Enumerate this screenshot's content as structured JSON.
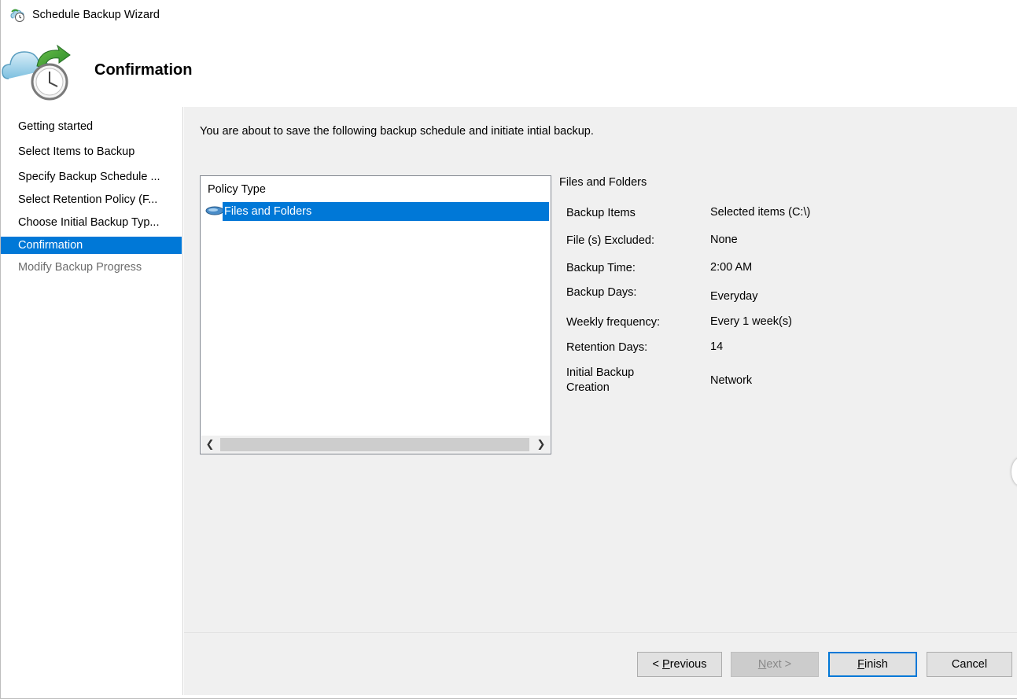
{
  "window": {
    "title": "Schedule Backup Wizard"
  },
  "header": {
    "title": "Confirmation",
    "icon": "cloud-backup-clock-icon"
  },
  "nav": {
    "items": [
      {
        "label": "Getting started",
        "state": "normal"
      },
      {
        "label": "Select Items to Backup",
        "state": "normal"
      },
      {
        "label": "Specify Backup Schedule ...",
        "state": "normal"
      },
      {
        "label": "Select Retention Policy (F...",
        "state": "normal"
      },
      {
        "label": "Choose Initial Backup Typ...",
        "state": "normal"
      },
      {
        "label": "Confirmation",
        "state": "selected"
      },
      {
        "label": "Modify Backup Progress",
        "state": "disabled"
      }
    ]
  },
  "main": {
    "intro": "You are about to save the following backup schedule and initiate intial backup.",
    "policy_list": {
      "header": "Policy Type",
      "selected_item": "Files and Folders"
    },
    "details": {
      "title": "Files and Folders",
      "rows": [
        {
          "label": "Backup Items",
          "value": "Selected items (C:\\)"
        },
        {
          "label": "File (s) Excluded:",
          "value": "None"
        },
        {
          "label": "Backup Time:",
          "value": "2:00 AM"
        },
        {
          "label": "Backup Days:",
          "value": "Everyday"
        },
        {
          "label": "Weekly frequency:",
          "value": "Every 1 week(s)"
        },
        {
          "label": "Retention Days:",
          "value": "14"
        },
        {
          "label": "Initial Backup\nCreation",
          "value": "Network"
        }
      ]
    }
  },
  "footer": {
    "previous_label": "< Previous",
    "previous_mnemonic": "P",
    "next_label": "Next >",
    "next_mnemonic": "N",
    "finish_label": "Finish",
    "finish_mnemonic": "F",
    "cancel_label": "Cancel"
  },
  "colors": {
    "accent": "#0078d7",
    "panel": "#f0f0f0"
  }
}
